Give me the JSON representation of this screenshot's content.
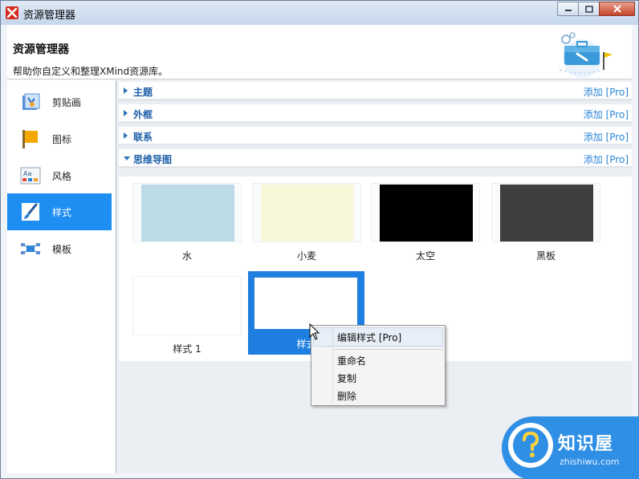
{
  "window": {
    "title": "资源管理器",
    "buttons": [
      "minimize",
      "maximize",
      "close"
    ]
  },
  "header": {
    "title": "资源管理器",
    "subtitle": "帮助你自定义和整理XMind资源库。",
    "art_icon": "toolbox-gear-flag-icon"
  },
  "sidebar": {
    "items": [
      {
        "label": "剪贴画",
        "icon": "clipart-icon",
        "active": false
      },
      {
        "label": "图标",
        "icon": "flag-icon",
        "active": false
      },
      {
        "label": "风格",
        "icon": "font-style-icon",
        "active": false
      },
      {
        "label": "样式",
        "icon": "paint-brush-icon",
        "active": true
      },
      {
        "label": "模板",
        "icon": "template-icon",
        "active": false
      }
    ]
  },
  "sections": [
    {
      "title": "主题",
      "add": "添加 [Pro]",
      "expanded": false
    },
    {
      "title": "外框",
      "add": "添加 [Pro]",
      "expanded": false
    },
    {
      "title": "联系",
      "add": "添加 [Pro]",
      "expanded": false
    },
    {
      "title": "思维导图",
      "add": "添加 [Pro]",
      "expanded": true
    }
  ],
  "styles": [
    {
      "name": "水",
      "color": "#bcdbe6"
    },
    {
      "name": "小麦",
      "color": "#f8f7da"
    },
    {
      "name": "太空",
      "color": "#000000"
    },
    {
      "name": "黑板",
      "color": "#3f3f3f"
    },
    {
      "name": "样式 1",
      "color": "#ffffff"
    },
    {
      "name": "样式",
      "color": "#ffffff",
      "selected": true
    }
  ],
  "context_menu": {
    "items": [
      "编辑样式 [Pro]",
      "重命名",
      "复制",
      "删除"
    ]
  },
  "watermark": {
    "brand": "知识屋",
    "domain": "zhishiwu.com"
  },
  "colors": {
    "accent": "#1e8ef2",
    "link": "#2a85d8",
    "section_title": "#1d5ea8"
  }
}
